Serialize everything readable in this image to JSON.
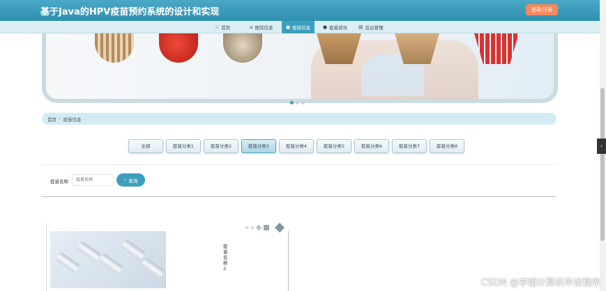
{
  "header": {
    "title": "基于Java的HPV疫苗预约系统的设计和实现",
    "login_label": "登录/注册"
  },
  "nav": {
    "items": [
      {
        "label": "首页",
        "icon": "star-icon"
      },
      {
        "label": "医院信息",
        "icon": "hospital-icon"
      },
      {
        "label": "疫苗信息",
        "icon": "circle-icon"
      },
      {
        "label": "疫苗资讯",
        "icon": "circle-icon"
      },
      {
        "label": "后台管理",
        "icon": "building-icon"
      }
    ],
    "active_index": 2
  },
  "breadcrumb": {
    "home": "首页",
    "separator": "፧",
    "current": "疫苗信息"
  },
  "categories": {
    "items": [
      "全部",
      "疫苗分类1",
      "疫苗分类2",
      "疫苗分类3",
      "疫苗分类4",
      "疫苗分类5",
      "疫苗分类6",
      "疫苗分类7",
      "疫苗分类8"
    ],
    "active_index": 3
  },
  "search": {
    "label": "疫苗名称",
    "placeholder": "疫苗名称",
    "button_label": "查询"
  },
  "card": {
    "name": "疫苗名称3"
  },
  "watermark": "CSDN @学姐计算机毕设程序",
  "colors": {
    "primary": "#3d9fbe",
    "header": "#2f8fb0",
    "login": "#f28a5c"
  }
}
